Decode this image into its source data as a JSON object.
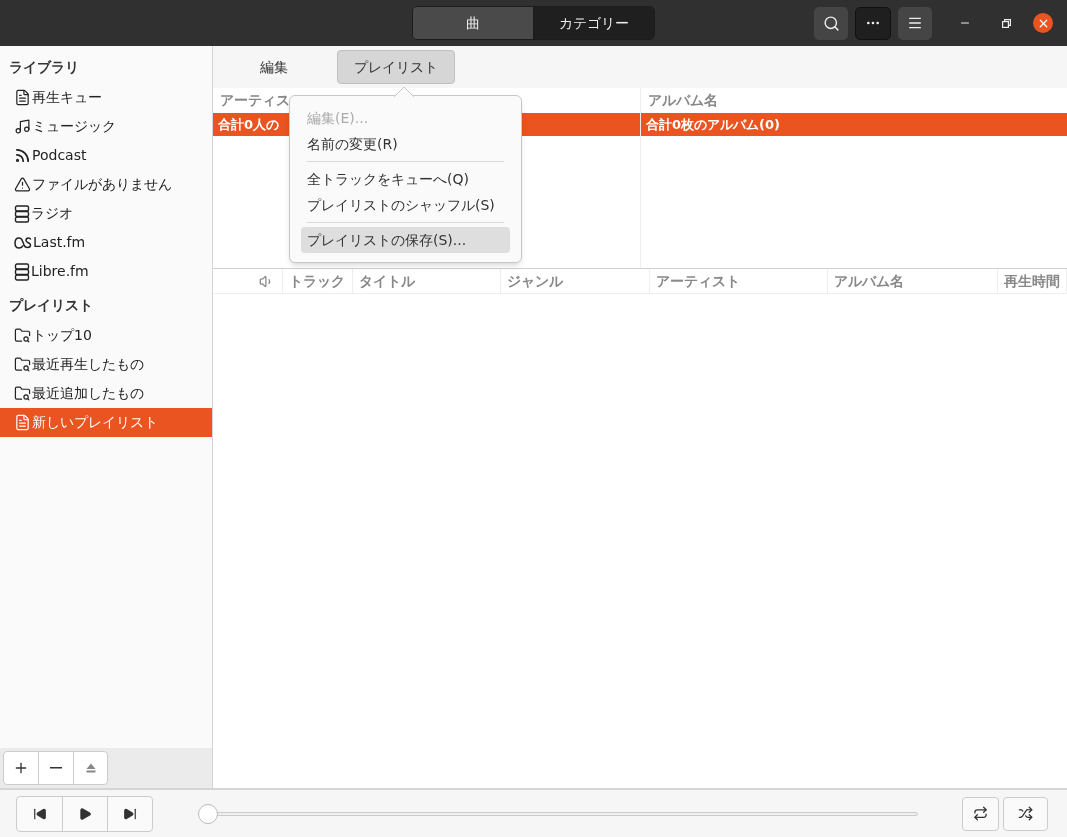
{
  "header": {
    "view_switch": [
      {
        "label": "曲",
        "selected": true
      },
      {
        "label": "カテゴリー",
        "selected": false
      }
    ]
  },
  "sidebar": {
    "sections": [
      {
        "title": "ライブラリ",
        "items": [
          {
            "label": "再生キュー",
            "kind": "document",
            "selected": false
          },
          {
            "label": "ミュージック",
            "kind": "music",
            "selected": false
          },
          {
            "label": "Podcast",
            "kind": "feed",
            "selected": false
          },
          {
            "label": "ファイルがありません",
            "kind": "warning",
            "selected": false
          },
          {
            "label": "ラジオ",
            "kind": "server",
            "selected": false
          },
          {
            "label": "Last.fm",
            "kind": "lastfm",
            "selected": false
          },
          {
            "label": "Libre.fm",
            "kind": "server",
            "selected": false
          }
        ]
      },
      {
        "title": "プレイリスト",
        "items": [
          {
            "label": "トップ10",
            "kind": "smartfolder",
            "selected": false
          },
          {
            "label": "最近再生したもの",
            "kind": "smartfolder",
            "selected": false
          },
          {
            "label": "最近追加したもの",
            "kind": "smartfolder",
            "selected": false
          },
          {
            "label": "新しいプレイリスト",
            "kind": "document",
            "selected": true
          }
        ]
      }
    ]
  },
  "toolbar": {
    "tabs": [
      {
        "label": "編集",
        "selected": false
      },
      {
        "label": "プレイリスト",
        "selected": true
      }
    ]
  },
  "menu": {
    "items": [
      {
        "kind": "item",
        "label": "編集(E)...",
        "disabled": true,
        "selected": false
      },
      {
        "kind": "item",
        "label": "名前の変更(R)",
        "disabled": false,
        "selected": false
      },
      {
        "kind": "separator"
      },
      {
        "kind": "item",
        "label": "全トラックをキューへ(Q)",
        "disabled": false,
        "selected": false
      },
      {
        "kind": "item",
        "label": "プレイリストのシャッフル(S)",
        "disabled": false,
        "selected": false
      },
      {
        "kind": "separator"
      },
      {
        "kind": "item",
        "label": "プレイリストの保存(S)...",
        "disabled": false,
        "selected": true
      }
    ]
  },
  "browser": {
    "columns": [
      {
        "header": "アーティス",
        "rows": [
          {
            "text": "合計0人の",
            "selected": true
          }
        ]
      },
      {
        "header": "アルバム名",
        "rows": [
          {
            "text": "合計0枚のアルバム(0)",
            "selected": true
          }
        ]
      }
    ]
  },
  "track_list": {
    "columns": [
      "トラック",
      "タイトル",
      "ジャンル",
      "アーティスト",
      "アルバム名",
      "再生時間"
    ]
  },
  "player": {
    "position": {
      "level": 0
    }
  }
}
